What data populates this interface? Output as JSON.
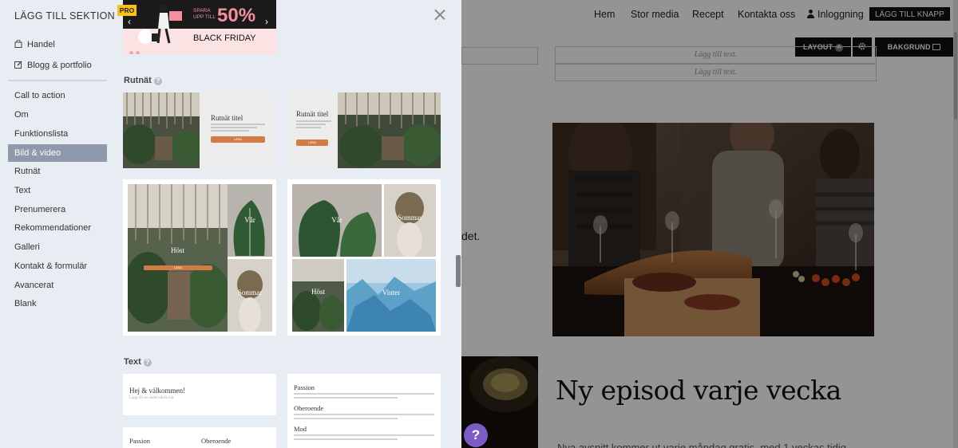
{
  "panel": {
    "title": "LÄGG TILL SEKTION",
    "categories": [
      {
        "label": "Handel",
        "icon": "shopping-bag-icon"
      },
      {
        "label": "Blogg & portfolio",
        "icon": "edit-icon"
      }
    ],
    "items": [
      "Call to action",
      "Om",
      "Funktionslista",
      "Bild & video",
      "Rutnät",
      "Text",
      "Prenumerera",
      "Rekommendationer",
      "Galleri",
      "Kontakt & formulär",
      "Avancerat",
      "Blank"
    ],
    "active_item": "Bild & video",
    "banner": {
      "badge": "PRO",
      "spara": "SPARA",
      "upp_till": "UPP TILL",
      "percent": "50%",
      "black_friday": "BLACK FRIDAY"
    },
    "sections": {
      "rutnat": "Rutnät",
      "text": "Text"
    },
    "rutnat_cards": {
      "title_a": "Rutnät titel",
      "title_b": "Rutnät titel",
      "btn": "LÄSA"
    },
    "grid_tiles": {
      "host": "Höst",
      "var": "Vår",
      "sommar": "Sommar",
      "vinter": "Vinter",
      "btn": "LÄSA"
    },
    "text_cards": {
      "welcome": "Hej & välkommen!",
      "welcome_sub": "Lägg till en underrubrik här",
      "passion": "Passion",
      "oberoende": "Oberoende",
      "mod": "Mod"
    }
  },
  "site": {
    "nav": [
      "Hem",
      "Stor media",
      "Recept",
      "Kontakta oss"
    ],
    "login": "Inloggning",
    "add_button": "LÄGG TILL KNAPP",
    "layout_btn": "LAYOUT",
    "layout_badge": "A",
    "bakgrund_btn": "BAKGRUND",
    "add_text_1": "Lägg till text.",
    "add_text_2": "Lägg till text.",
    "stray_text": "det.",
    "heading": "Ny episod varje vecka",
    "paragraph": "Nya avsnitt kommer ut varje måndag gratis, med 1 veckas tidig",
    "help": "?"
  }
}
